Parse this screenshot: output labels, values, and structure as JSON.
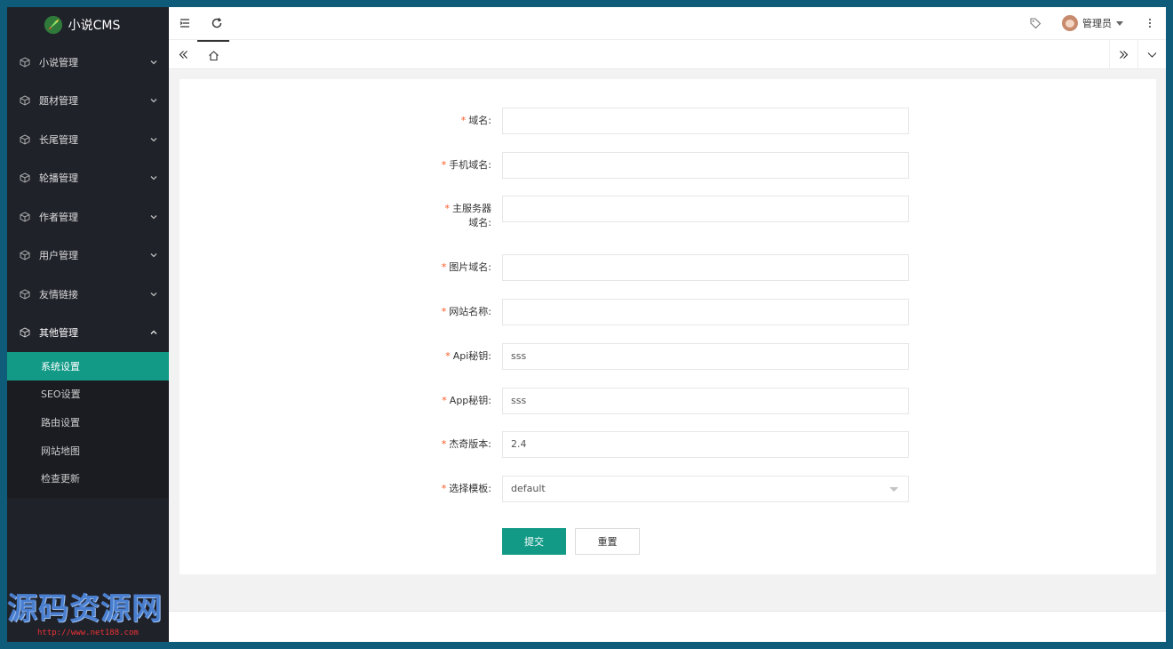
{
  "app": {
    "logo_text": "小说CMS"
  },
  "sidebar": {
    "items": [
      {
        "label": "小说管理"
      },
      {
        "label": "题材管理"
      },
      {
        "label": "长尾管理"
      },
      {
        "label": "轮播管理"
      },
      {
        "label": "作者管理"
      },
      {
        "label": "用户管理"
      },
      {
        "label": "友情链接"
      },
      {
        "label": "其他管理"
      }
    ],
    "sub_items": [
      {
        "label": "系统设置",
        "active": true
      },
      {
        "label": "SEO设置"
      },
      {
        "label": "路由设置"
      },
      {
        "label": "网站地图"
      },
      {
        "label": "检查更新"
      }
    ]
  },
  "header": {
    "user_name": "管理员"
  },
  "form": {
    "fields": [
      {
        "label": "域名:",
        "value": ""
      },
      {
        "label": "手机域名:",
        "value": ""
      },
      {
        "label_line1": "主服务器",
        "label_line2": "域名:",
        "value": ""
      },
      {
        "label": "图片域名:",
        "value": ""
      },
      {
        "label": "网站名称:",
        "value": ""
      },
      {
        "label": "Api秘钥:",
        "value": "sss"
      },
      {
        "label": "App秘钥:",
        "value": "sss"
      },
      {
        "label": "杰奇版本:",
        "value": "2.4"
      },
      {
        "label": "选择模板:",
        "value": "default"
      }
    ],
    "required_mark": "*",
    "submit_label": "提交",
    "reset_label": "重置"
  },
  "watermark": {
    "text": "源码资源网",
    "url": "http://www.net188.com"
  },
  "colors": {
    "accent": "#129a87",
    "sidebar": "#20222a",
    "required": "#ff5722"
  }
}
